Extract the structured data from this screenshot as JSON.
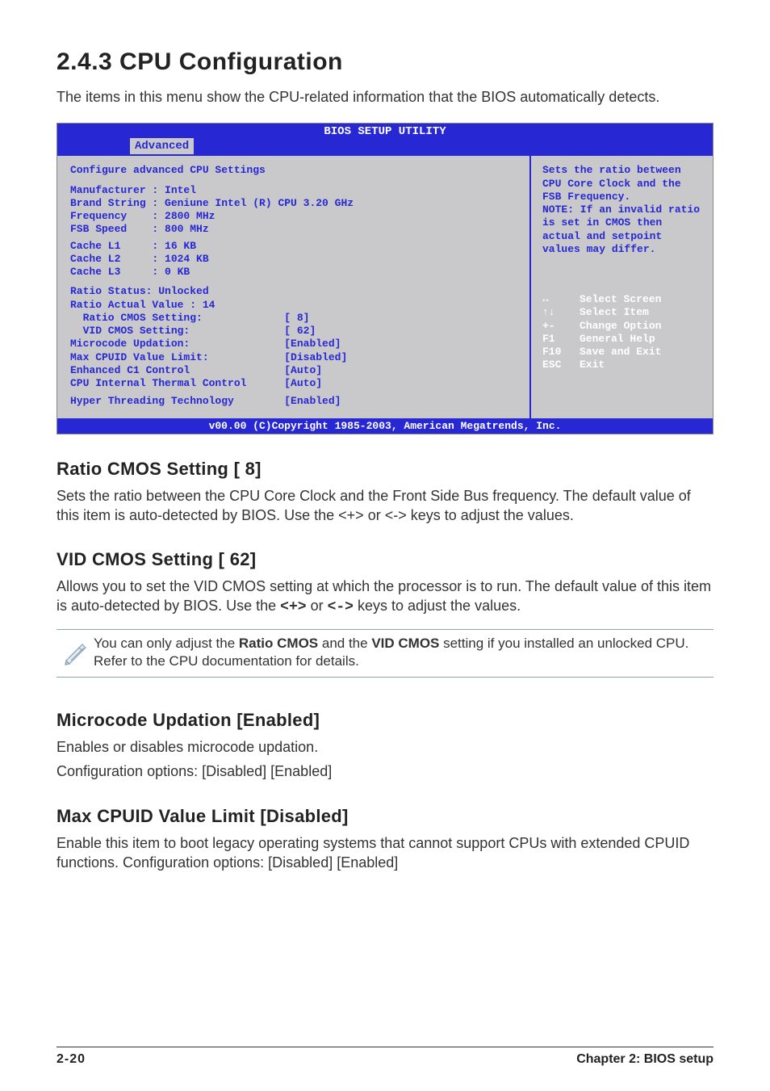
{
  "title": "2.4.3   CPU Configuration",
  "intro": "The items in this menu show the CPU-related information that the BIOS automatically detects.",
  "bios": {
    "header": "BIOS SETUP UTILITY",
    "tab": "Advanced",
    "left_title": "Configure advanced CPU Settings",
    "info": [
      "Manufacturer : Intel",
      "Brand String : Geniune Intel (R) CPU 3.20 GHz",
      "Frequency    : 2800 MHz",
      "FSB Speed    : 800 MHz"
    ],
    "cache": [
      "Cache L1     : 16 KB",
      "Cache L2     : 1024 KB",
      "Cache L3     : 0 KB"
    ],
    "ratio_status": "Ratio Status: Unlocked",
    "ratio_actual": "Ratio Actual Value : 14",
    "settings": [
      {
        "label": "  Ratio CMOS Setting:",
        "value": "[ 8]"
      },
      {
        "label": "  VID CMOS Setting:",
        "value": "[ 62]"
      },
      {
        "label": "Microcode Updation:",
        "value": "[Enabled]"
      },
      {
        "label": "Max CPUID Value Limit:",
        "value": "[Disabled]"
      },
      {
        "label": "Enhanced C1 Control",
        "value": "[Auto]"
      },
      {
        "label": "CPU Internal Thermal Control",
        "value": "[Auto]"
      }
    ],
    "hyper": {
      "label": "Hyper Threading Technology",
      "value": "[Enabled]"
    },
    "help": "Sets the ratio between CPU Core Clock and the FSB Frequency.\nNOTE: If an invalid ratio is set in CMOS then actual and setpoint values may differ.",
    "keys": [
      {
        "sym": "↔",
        "label": "Select Screen"
      },
      {
        "sym": "↑↓",
        "label": "Select Item"
      },
      {
        "sym": "+-",
        "label": "Change Option"
      },
      {
        "sym": "F1",
        "label": "General Help"
      },
      {
        "sym": "F10",
        "label": "Save and Exit"
      },
      {
        "sym": "ESC",
        "label": "Exit"
      }
    ],
    "footer": "v00.00 (C)Copyright 1985-2003, American Megatrends, Inc."
  },
  "sec_ratio": {
    "heading": "Ratio CMOS Setting [ 8]",
    "body": "Sets the ratio between the CPU Core Clock and the Front Side Bus frequency. The default value of this item is auto-detected by BIOS. Use the <+> or <-> keys to adjust the values."
  },
  "sec_vid": {
    "heading": "VID CMOS Setting [ 62]",
    "body_pre": "Allows you to set the VID CMOS setting at which the processor is to run. The default value of this item is auto-detected by BIOS. Use the ",
    "key_plus": "<+>",
    "body_mid": " or ",
    "key_minus": "<->",
    "body_post": " keys to adjust the values."
  },
  "note": {
    "pre": "You can only adjust the ",
    "b1": "Ratio CMOS",
    "mid": " and the ",
    "b2": "VID CMOS",
    "post": " setting if you installed an unlocked CPU. Refer to the CPU documentation for details."
  },
  "sec_micro": {
    "heading": "Microcode Updation [Enabled]",
    "body1": "Enables or disables microcode updation.",
    "body2": "Configuration options: [Disabled] [Enabled]"
  },
  "sec_cpuid": {
    "heading": "Max CPUID Value Limit [Disabled]",
    "body": "Enable this item to boot legacy operating systems that cannot support CPUs with extended CPUID functions. Configuration options: [Disabled] [Enabled]"
  },
  "footer": {
    "page": "2-20",
    "chapter": "Chapter 2: BIOS setup"
  }
}
